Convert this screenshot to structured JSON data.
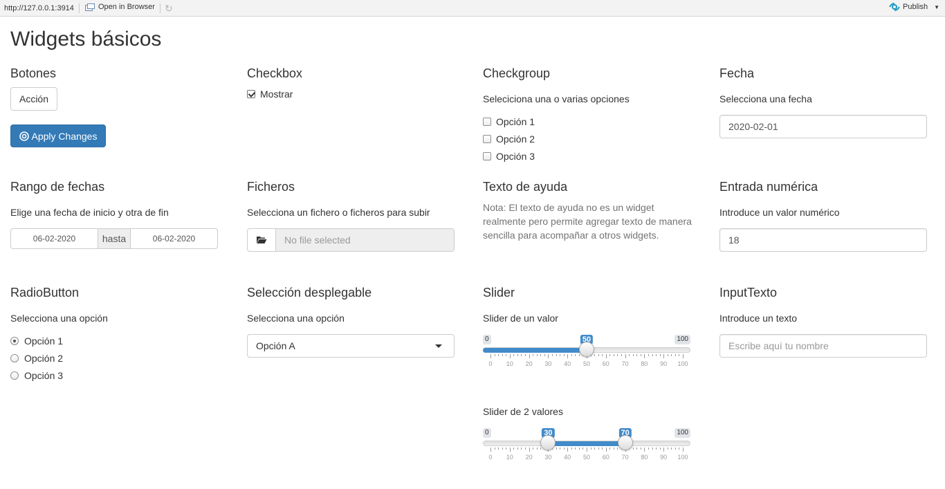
{
  "browser": {
    "url": "http://127.0.0.1:3914",
    "open_in_browser": "Open in Browser",
    "publish": "Publish"
  },
  "page_title": "Widgets básicos",
  "botones": {
    "title": "Botones",
    "action_label": "Acción",
    "apply_label": "Apply Changes"
  },
  "checkbox": {
    "title": "Checkbox",
    "label": "Mostrar",
    "checked": true
  },
  "checkgroup": {
    "title": "Checkgroup",
    "label": "Seleciciona una o varias opciones",
    "options": [
      "Opción 1",
      "Opción 2",
      "Opción 3"
    ]
  },
  "fecha": {
    "title": "Fecha",
    "label": "Selecciona una fecha",
    "value": "2020-02-01"
  },
  "rango": {
    "title": "Rango de fechas",
    "label": "Elige una fecha de inicio y otra de fin",
    "start": "06-02-2020",
    "separator": "hasta",
    "end": "06-02-2020"
  },
  "ficheros": {
    "title": "Ficheros",
    "label": "Selecciona un fichero o ficheros para subir",
    "placeholder": "No file selected"
  },
  "ayuda": {
    "title": "Texto de ayuda",
    "text": "Nota: El texto de ayuda no es un widget realmente pero permite agregar texto de manera sencilla para acompañar a otros widgets."
  },
  "numerica": {
    "title": "Entrada numérica",
    "label": "Introduce un valor numérico",
    "value": "18"
  },
  "radio": {
    "title": "RadioButton",
    "label": "Selecciona una opción",
    "options": [
      "Opción 1",
      "Opción 2",
      "Opción 3"
    ],
    "selected_index": 0
  },
  "select": {
    "title": "Selección desplegable",
    "label": "Selecciona una opción",
    "value": "Opción A"
  },
  "slider": {
    "title": "Slider",
    "single": {
      "label": "Slider de un valor",
      "min": 0,
      "max": 100,
      "value": 50
    },
    "range": {
      "label": "Slider de 2 valores",
      "min": 0,
      "max": 100,
      "from": 30,
      "to": 70
    },
    "tick_labels": [
      "0",
      "10",
      "20",
      "30",
      "40",
      "50",
      "60",
      "70",
      "80",
      "90",
      "100"
    ]
  },
  "texto": {
    "title": "InputTexto",
    "label": "Introduce un texto",
    "placeholder": "Escribe aquí tu nombre"
  }
}
